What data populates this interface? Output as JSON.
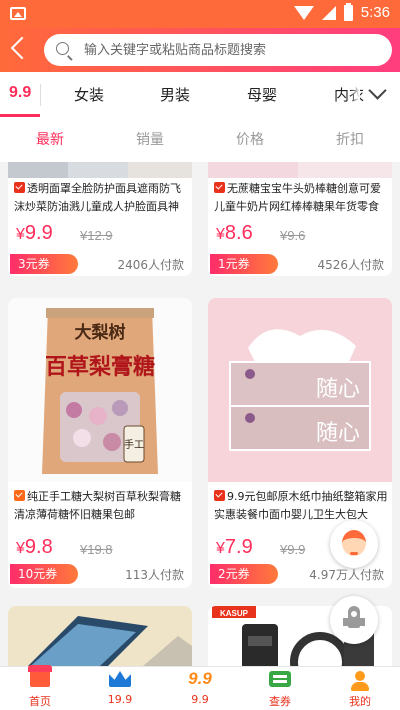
{
  "status_bar": {
    "time": "5:36"
  },
  "search": {
    "placeholder": "输入关键字或粘贴商品标题搜索"
  },
  "category_tabs": [
    "9.9",
    "女装",
    "男装",
    "母婴",
    "内衣"
  ],
  "sort_tabs": [
    "最新",
    "销量",
    "价格",
    "折扣"
  ],
  "products": [
    {
      "title": "透明面罩全脸防护面具遮雨防飞沫炒菜防油溅儿童成人护脸面具神",
      "currency": "¥",
      "price": "9.9",
      "orig_price": "¥12.9",
      "coupon": "3元券",
      "sold": "2406人付款"
    },
    {
      "title": "无蔗糖宝宝牛头奶棒糖创意可爱儿童牛奶片网红棒棒糖果年货零食",
      "currency": "¥",
      "price": "8.6",
      "orig_price": "¥9.6",
      "coupon": "1元券",
      "sold": "4526人付款"
    },
    {
      "title": "纯正手工糖大梨树百草秋梨膏糖清凉薄荷糖怀旧糖果包邮",
      "currency": "¥",
      "price": "9.8",
      "orig_price": "¥19.8",
      "coupon": "10元券",
      "sold": "113人付款",
      "image_text": {
        "top": "大梨树",
        "main": "百草梨膏糖",
        "seal": "手工"
      }
    },
    {
      "title": "9.9元包邮原木纸巾抽纸整箱家用实惠装餐巾面巾婴儿卫生大包大",
      "currency": "¥",
      "price": "7.9",
      "orig_price": "¥9.9",
      "coupon": "2元券",
      "sold": "4.97万人付款",
      "image_text": {
        "brand": "随心"
      }
    },
    {
      "title": "",
      "image_text": {
        "brand": "KASUP"
      }
    }
  ],
  "bottom_nav": [
    "首页",
    "19.9",
    "9.9",
    "查券",
    "我的"
  ],
  "colors": {
    "accent": "#ff2d5a",
    "header_start": "#ff6a3a",
    "header_end": "#ff3d7f"
  }
}
